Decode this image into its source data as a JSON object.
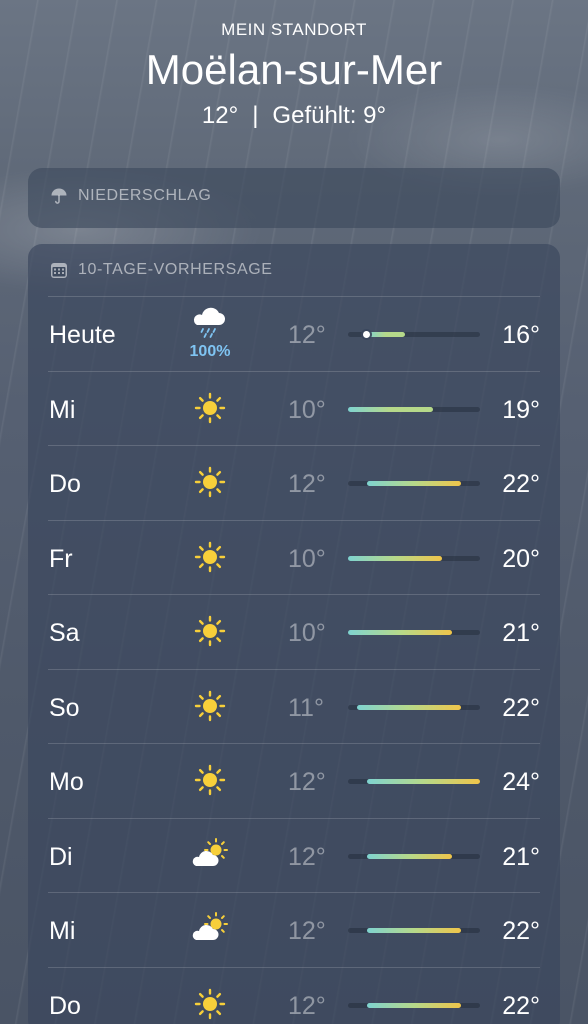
{
  "header": {
    "location_label": "MEIN STANDORT",
    "city": "Moëlan-sur-Mer",
    "current_temp": "12°",
    "separator": "|",
    "feels_like": "Gefühlt: 9°"
  },
  "precipitation_card": {
    "icon": "umbrella-icon",
    "title": "NIEDERSCHLAG"
  },
  "forecast_card": {
    "icon": "calendar-icon",
    "title": "10-TAGE-VORHERSAGE",
    "range_min": 10,
    "range_max": 24,
    "current_temp_value": 12,
    "days": [
      {
        "day": "Heute",
        "icon": "rain-cloud-icon",
        "precip": "100%",
        "low": "12°",
        "high": "16°",
        "low_val": 12,
        "high_val": 16,
        "show_now": true
      },
      {
        "day": "Mi",
        "icon": "sun-icon",
        "precip": "",
        "low": "10°",
        "high": "19°",
        "low_val": 10,
        "high_val": 19,
        "show_now": false
      },
      {
        "day": "Do",
        "icon": "sun-icon",
        "precip": "",
        "low": "12°",
        "high": "22°",
        "low_val": 12,
        "high_val": 22,
        "show_now": false
      },
      {
        "day": "Fr",
        "icon": "sun-icon",
        "precip": "",
        "low": "10°",
        "high": "20°",
        "low_val": 10,
        "high_val": 20,
        "show_now": false
      },
      {
        "day": "Sa",
        "icon": "sun-icon",
        "precip": "",
        "low": "10°",
        "high": "21°",
        "low_val": 10,
        "high_val": 21,
        "show_now": false
      },
      {
        "day": "So",
        "icon": "sun-icon",
        "precip": "",
        "low": "11°",
        "high": "22°",
        "low_val": 11,
        "high_val": 22,
        "show_now": false
      },
      {
        "day": "Mo",
        "icon": "sun-icon",
        "precip": "",
        "low": "12°",
        "high": "24°",
        "low_val": 12,
        "high_val": 24,
        "show_now": false
      },
      {
        "day": "Di",
        "icon": "partly-cloudy-icon",
        "precip": "",
        "low": "12°",
        "high": "21°",
        "low_val": 12,
        "high_val": 21,
        "show_now": false
      },
      {
        "day": "Mi",
        "icon": "partly-cloudy-icon",
        "precip": "",
        "low": "12°",
        "high": "22°",
        "low_val": 12,
        "high_val": 22,
        "show_now": false
      },
      {
        "day": "Do",
        "icon": "sun-icon",
        "precip": "",
        "low": "12°",
        "high": "22°",
        "low_val": 12,
        "high_val": 22,
        "show_now": false
      }
    ]
  },
  "colors": {
    "sun": "#f7cf3a",
    "cool": "#7fd3d0",
    "mild": "#b6d98a",
    "warm": "#f0c54a",
    "precip_text": "#7fc4f2"
  }
}
